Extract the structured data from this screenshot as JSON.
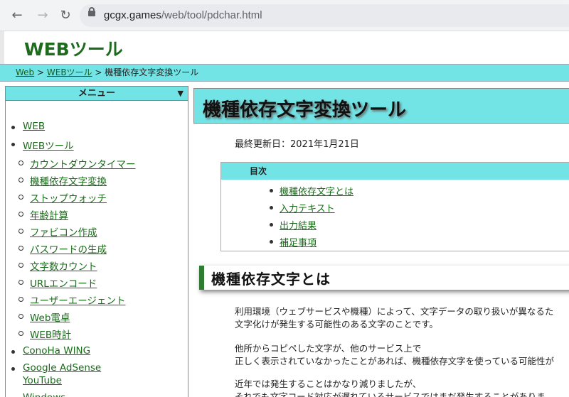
{
  "browser": {
    "url_host": "gcgx.games",
    "url_path": "/web/tool/pdchar.html",
    "icons": [
      "back-arrow-icon",
      "forward-arrow-icon",
      "reload-icon",
      "lock-icon"
    ]
  },
  "header": {
    "site_title": "WEBツール"
  },
  "breadcrumb": {
    "items": [
      "Web",
      "WEBツール",
      "機種依存文字変換ツール"
    ],
    "separator": ">"
  },
  "sidebar": {
    "menu_title": "メニュー",
    "menu_arrow": "▼",
    "items": [
      {
        "label": "WEB",
        "level": 1
      },
      {
        "label": "WEBツール",
        "level": 1
      },
      {
        "label": "カウントダウンタイマー",
        "level": 2
      },
      {
        "label": "機種依存文字変換",
        "level": 2
      },
      {
        "label": "ストップウォッチ",
        "level": 2
      },
      {
        "label": "年齢計算",
        "level": 2
      },
      {
        "label": "ファビコン作成",
        "level": 2
      },
      {
        "label": "パスワードの生成",
        "level": 2
      },
      {
        "label": "文字数カウント",
        "level": 2
      },
      {
        "label": "URLエンコード",
        "level": 2
      },
      {
        "label": "ユーザーエージェント",
        "level": 2
      },
      {
        "label": "Web電卓",
        "level": 2
      },
      {
        "label": "WEB時計",
        "level": 2
      },
      {
        "label": "ConoHa WING",
        "level": 1
      },
      {
        "label": "Google AdSense",
        "level": 1
      },
      {
        "label": "YouTube",
        "level": 1
      },
      {
        "label": "Windows",
        "level": 1
      }
    ]
  },
  "main": {
    "title": "機種依存文字変換ツール",
    "updated": "最終更新日：2021年1月21日",
    "toc": {
      "heading": "目次",
      "items": [
        "機種依存文字とは",
        "入力テキスト",
        "出力結果",
        "補足事項"
      ]
    },
    "section_heading": "機種依存文字とは",
    "paragraphs": [
      "利用環境（ウェブサービスや機種）によって、文字データの取り扱いが異なるた",
      "文字化けが発生する可能性のある文字のことです。",
      "他所からコピペした文字が、他のサービス上で",
      "正しく表示されていなかったことがあれば、機種依存文字を使っている可能性が",
      "近年では発生することはかなり減りましたが、",
      "それでも文字コード対応が遅れているサービスではまだ発生することがありま"
    ]
  },
  "colors": {
    "accent_cyan": "#72e4e6",
    "link_green": "#1a6b1a",
    "title_green": "#1e6b1e",
    "heading_bar": "#2e7d32"
  }
}
